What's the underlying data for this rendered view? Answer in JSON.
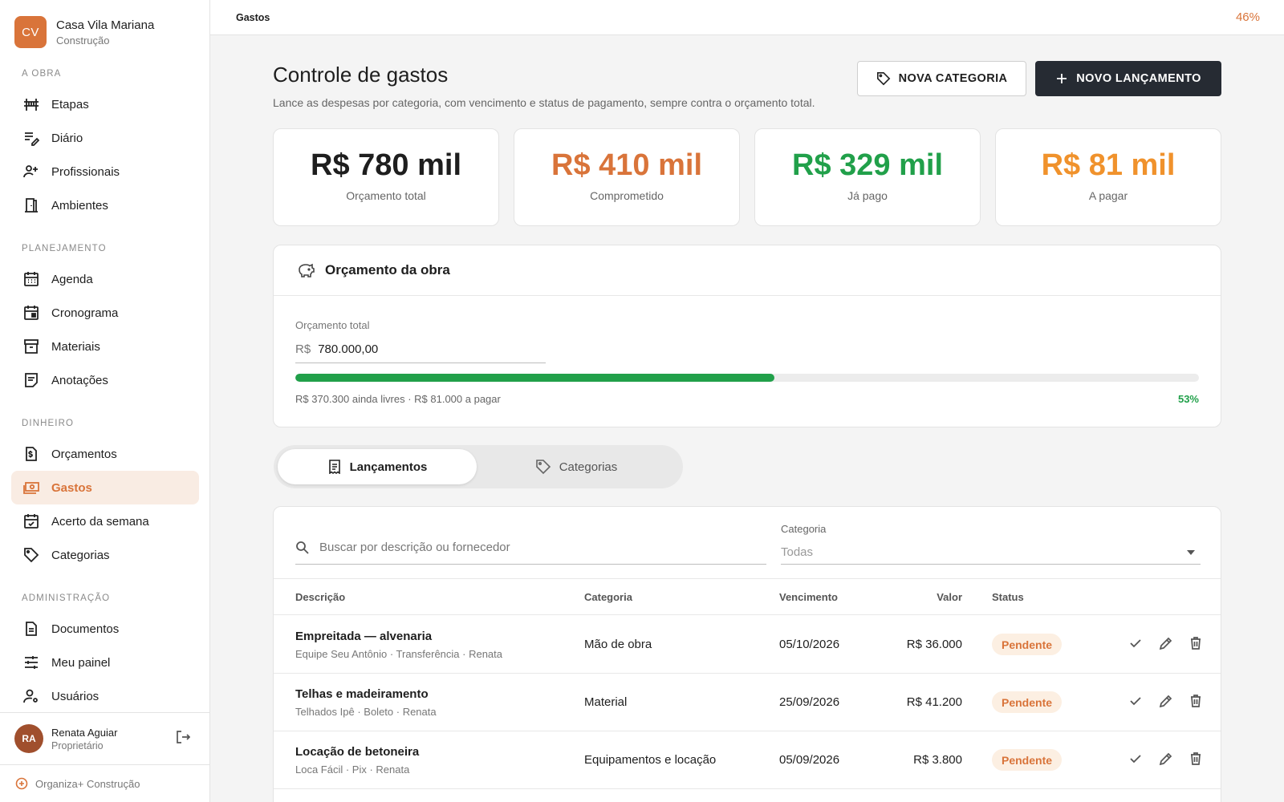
{
  "brand": {
    "initials": "CV",
    "name": "Casa Vila Mariana",
    "sub": "Construção",
    "color": "#d9743a"
  },
  "sections": {
    "obra": "A OBRA",
    "planejamento": "PLANEJAMENTO",
    "dinheiro": "DINHEIRO",
    "administracao": "ADMINISTRAÇÃO"
  },
  "nav": {
    "obra": [
      {
        "label": "Etapas",
        "icon": "bridge-icon"
      },
      {
        "label": "Diário",
        "icon": "notes-edit-icon"
      },
      {
        "label": "Profissionais",
        "icon": "people-gear-icon"
      },
      {
        "label": "Ambientes",
        "icon": "door-icon"
      }
    ],
    "planejamento": [
      {
        "label": "Agenda",
        "icon": "calendar-grid-icon"
      },
      {
        "label": "Cronograma",
        "icon": "calendar-event-icon"
      },
      {
        "label": "Materiais",
        "icon": "archive-icon"
      },
      {
        "label": "Anotações",
        "icon": "note-icon"
      }
    ],
    "dinheiro": [
      {
        "label": "Orçamentos",
        "icon": "receipt-dollar-icon"
      },
      {
        "label": "Gastos",
        "icon": "cash-icon",
        "active": true
      },
      {
        "label": "Acerto da semana",
        "icon": "calendar-check-icon"
      },
      {
        "label": "Categorias",
        "icon": "tag-icon"
      }
    ],
    "administracao": [
      {
        "label": "Documentos",
        "icon": "document-icon"
      },
      {
        "label": "Meu painel",
        "icon": "sliders-icon"
      },
      {
        "label": "Usuários",
        "icon": "user-gear-icon"
      }
    ]
  },
  "user": {
    "initials": "RA",
    "name": "Renata Aguiar",
    "role": "Proprietário"
  },
  "footer": {
    "label": "Organiza+ Construção"
  },
  "topbar": {
    "crumb": "Gastos",
    "zoom": "46%"
  },
  "page": {
    "title": "Controle de gastos",
    "subtitle": "Lance as despesas por categoria, com vencimento e status de pagamento, sempre contra o orçamento total."
  },
  "actions": {
    "new_category": "NOVA CATEGORIA",
    "new_entry": "NOVO LANÇAMENTO"
  },
  "stats": [
    {
      "value": "R$ 780 mil",
      "label": "Orçamento total",
      "color": "#1e1e1e"
    },
    {
      "value": "R$ 410 mil",
      "label": "Comprometido",
      "color": "#d9743a"
    },
    {
      "value": "R$ 329 mil",
      "label": "Já pago",
      "color": "#21a04a"
    },
    {
      "value": "R$ 81 mil",
      "label": "A pagar",
      "color": "#f0922c"
    }
  ],
  "budget": {
    "title": "Orçamento da obra",
    "field_label": "Orçamento total",
    "currency": "R$",
    "value": "780.000,00",
    "progress": 0.53,
    "note": "R$ 370.300 ainda livres · R$ 81.000 a pagar",
    "percent": "53%"
  },
  "tabs": [
    {
      "label": "Lançamentos",
      "active": true
    },
    {
      "label": "Categorias",
      "active": false
    }
  ],
  "filters": {
    "search_placeholder": "Buscar por descrição ou fornecedor",
    "category_label": "Categoria",
    "category_value": "Todas"
  },
  "table": {
    "headers": {
      "desc": "Descrição",
      "cat": "Categoria",
      "due": "Vencimento",
      "val": "Valor",
      "status": "Status"
    },
    "rows": [
      {
        "desc": "Empreitada — alvenaria",
        "meta": "Equipe Seu Antônio · Transferência · Renata",
        "cat": "Mão de obra",
        "due": "05/10/2026",
        "val": "R$ 36.000",
        "status": "Pendente"
      },
      {
        "desc": "Telhas e madeiramento",
        "meta": "Telhados Ipê · Boleto · Renata",
        "cat": "Material",
        "due": "25/09/2026",
        "val": "R$ 41.200",
        "status": "Pendente"
      },
      {
        "desc": "Locação de betoneira",
        "meta": "Loca Fácil · Pix · Renata",
        "cat": "Equipamentos e locação",
        "due": "05/09/2026",
        "val": "R$ 3.800",
        "status": "Pendente"
      }
    ]
  }
}
